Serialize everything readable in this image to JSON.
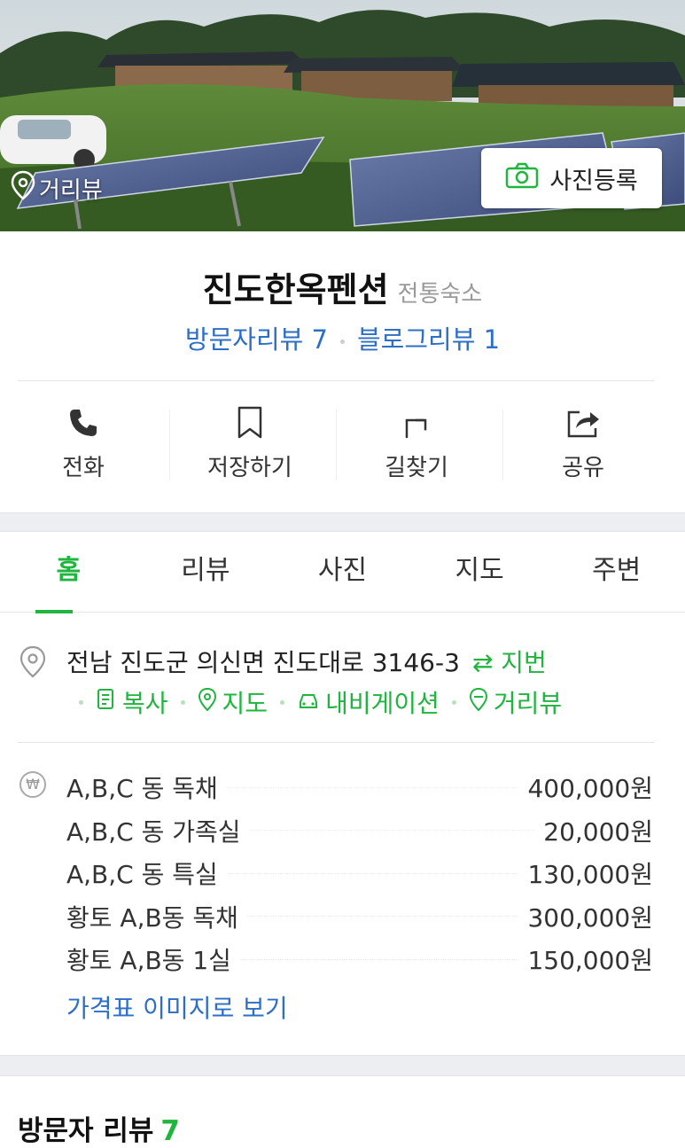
{
  "hero": {
    "roadview_label": "거리뷰",
    "photo_register_label": "사진등록"
  },
  "place": {
    "name": "진도한옥펜션",
    "category": "전통숙소",
    "visitor_review_label": "방문자리뷰 7",
    "blog_review_label": "블로그리뷰 1"
  },
  "actions": [
    {
      "label": "전화",
      "icon": "phone-icon"
    },
    {
      "label": "저장하기",
      "icon": "bookmark-icon"
    },
    {
      "label": "길찾기",
      "icon": "directions-icon"
    },
    {
      "label": "공유",
      "icon": "share-icon"
    }
  ],
  "tabs": [
    {
      "label": "홈",
      "active": true
    },
    {
      "label": "리뷰",
      "active": false
    },
    {
      "label": "사진",
      "active": false
    },
    {
      "label": "지도",
      "active": false
    },
    {
      "label": "주변",
      "active": false
    }
  ],
  "address": {
    "text": "전남 진도군 의신면 진도대로 3146-3",
    "jibun_label": "⇄ 지번",
    "links": {
      "copy": "복사",
      "map": "지도",
      "navigation": "내비게이션",
      "roadview": "거리뷰"
    }
  },
  "prices": {
    "won_symbol": "₩",
    "items": [
      {
        "name": "A,B,C 동 독채",
        "price": "400,000원"
      },
      {
        "name": "A,B,C 동 가족실",
        "price": "20,000원"
      },
      {
        "name": "A,B,C 동 특실",
        "price": "130,000원"
      },
      {
        "name": "황토 A,B동 독채",
        "price": "300,000원"
      },
      {
        "name": "황토 A,B동 1실",
        "price": "150,000원"
      }
    ],
    "image_link": "가격표 이미지로 보기"
  },
  "visitor_reviews": {
    "heading": "방문자 리뷰",
    "count": "7"
  },
  "colors": {
    "green": "#1fb53f",
    "blue": "#2d6ec6"
  }
}
